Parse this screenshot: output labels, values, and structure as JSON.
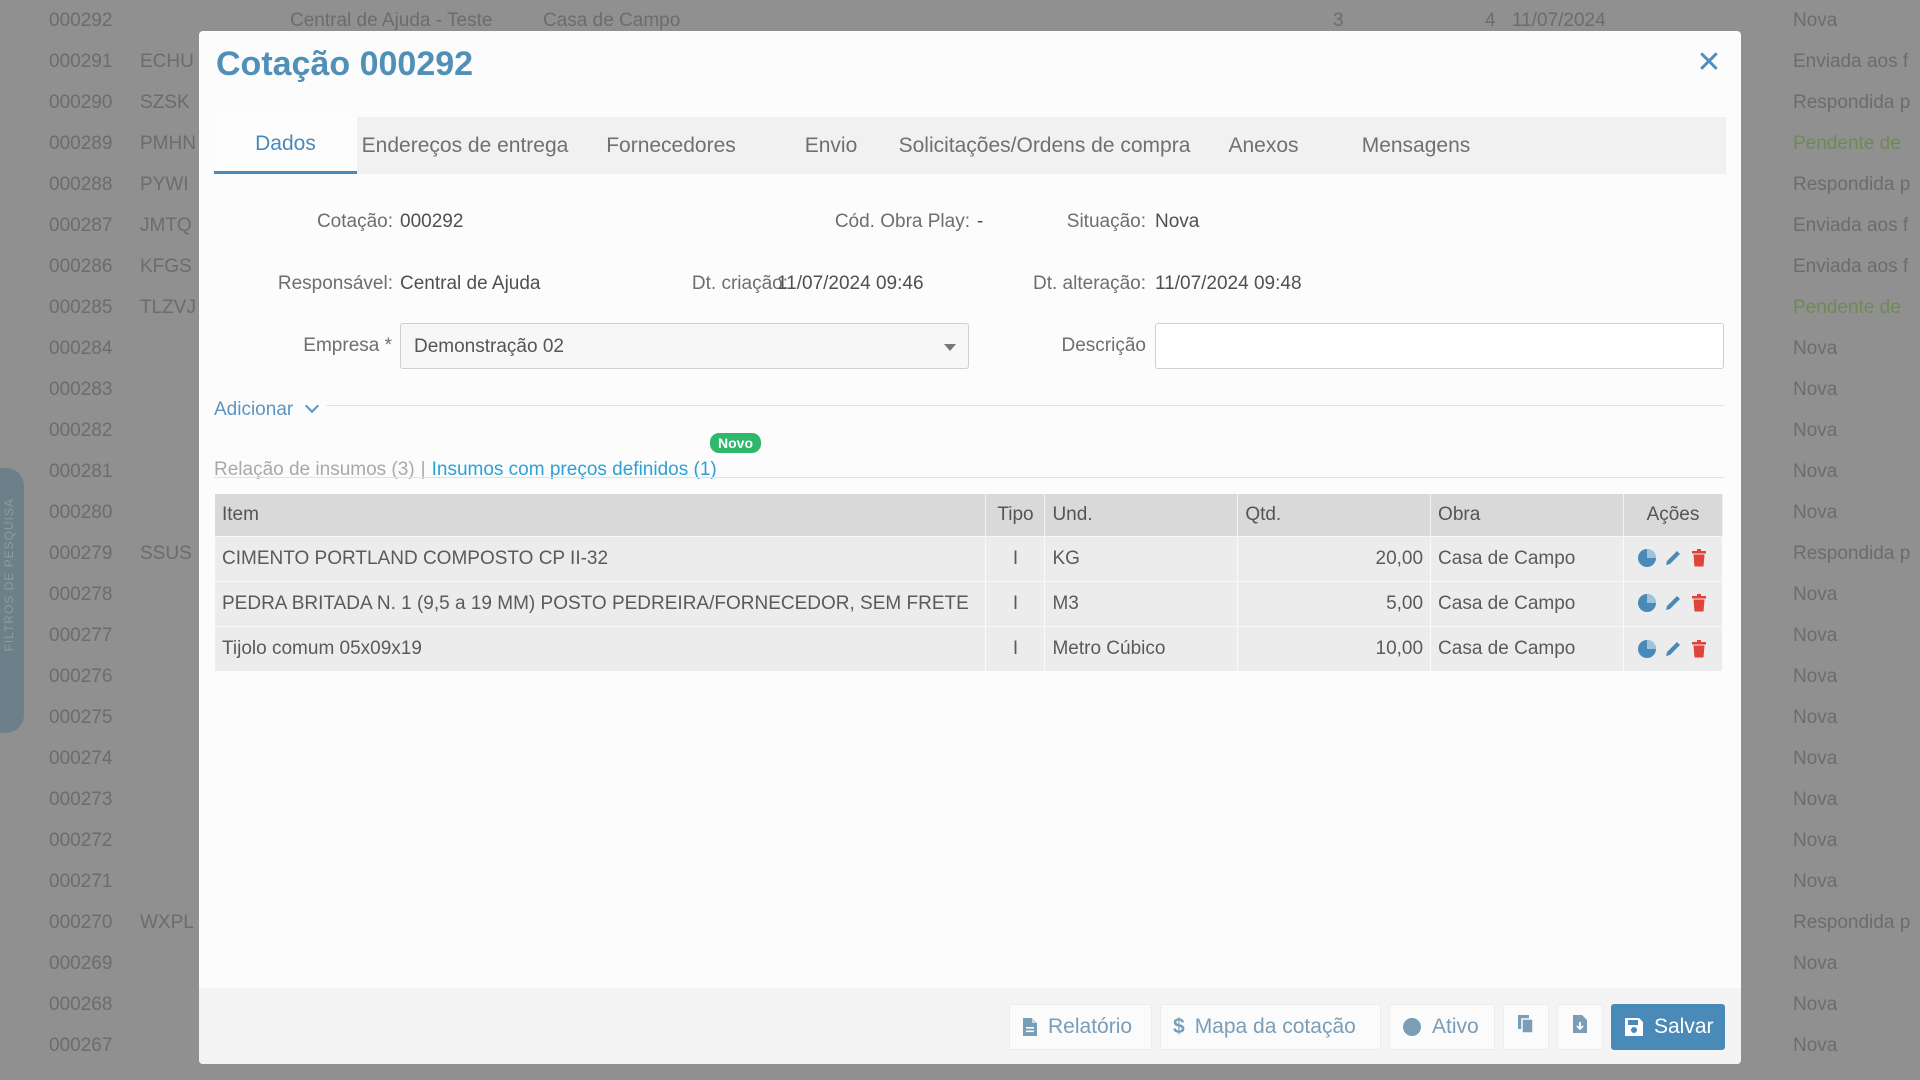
{
  "background": {
    "rows": [
      {
        "code": "000292",
        "key": "",
        "desc": "Central de Ajuda - Teste",
        "obra": "Casa de Campo",
        "n1": "3",
        "n2": "4",
        "date": "11/07/2024",
        "status": "Nova"
      },
      {
        "code": "000291",
        "key": "ECHU",
        "status": "Enviada aos f"
      },
      {
        "code": "000290",
        "key": "SZSK",
        "status": "Respondida p"
      },
      {
        "code": "000289",
        "key": "PMHN",
        "status": "Pendente de"
      },
      {
        "code": "000288",
        "key": "PYWI",
        "status": "Respondida p"
      },
      {
        "code": "000287",
        "key": "JMTQ",
        "status": "Enviada aos f"
      },
      {
        "code": "000286",
        "key": "KFGS",
        "status": "Enviada aos f"
      },
      {
        "code": "000285",
        "key": "TLZVJ",
        "status": "Pendente de"
      },
      {
        "code": "000284",
        "key": "",
        "status": "Nova"
      },
      {
        "code": "000283",
        "key": "",
        "status": "Nova"
      },
      {
        "code": "000282",
        "key": "",
        "status": "Nova"
      },
      {
        "code": "000281",
        "key": "",
        "status": "Nova"
      },
      {
        "code": "000280",
        "key": "",
        "status": "Nova"
      },
      {
        "code": "000279",
        "key": "SSUS",
        "status": "Respondida p"
      },
      {
        "code": "000278",
        "key": "",
        "status": "Nova"
      },
      {
        "code": "000277",
        "key": "",
        "status": "Nova"
      },
      {
        "code": "000276",
        "key": "",
        "status": "Nova"
      },
      {
        "code": "000275",
        "key": "",
        "status": "Nova"
      },
      {
        "code": "000274",
        "key": "",
        "status": "Nova"
      },
      {
        "code": "000273",
        "key": "",
        "status": "Nova"
      },
      {
        "code": "000272",
        "key": "",
        "status": "Nova"
      },
      {
        "code": "000271",
        "key": "",
        "status": "Nova"
      },
      {
        "code": "000270",
        "key": "WXPL",
        "status": "Respondida p"
      },
      {
        "code": "000269",
        "key": "",
        "status": "Nova"
      },
      {
        "code": "000268",
        "key": "",
        "status": "Nova"
      },
      {
        "code": "000267",
        "key": "",
        "status": "Nova"
      }
    ],
    "side_tab_label": "FILTROS DE PESQUISA"
  },
  "modal": {
    "title": "Cotação 000292",
    "tabs": [
      "Dados",
      "Endereços de entrega",
      "Fornecedores",
      "Envio",
      "Solicitações/Ordens de compra",
      "Anexos",
      "Mensagens"
    ],
    "fields": {
      "cotacao_label": "Cotação:",
      "cotacao_value": "000292",
      "cod_obra_label": "Cód. Obra Play:",
      "cod_obra_value": "-",
      "situacao_label": "Situação:",
      "situacao_value": "Nova",
      "responsavel_label": "Responsável:",
      "responsavel_value": "Central de Ajuda",
      "dt_criacao_label": "Dt. criação:",
      "dt_criacao_value": "11/07/2024 09:46",
      "dt_alteracao_label": "Dt. alteração:",
      "dt_alteracao_value": "11/07/2024 09:48",
      "empresa_label": "Empresa *",
      "empresa_value": "Demonstração 02",
      "descricao_label": "Descrição",
      "descricao_value": ""
    },
    "adicionar": "Adicionar",
    "sub_tabs": {
      "relacao": "Relação de insumos (3)",
      "separator": "|",
      "precos": "Insumos com preços definidos (1)",
      "badge": "Novo"
    },
    "table": {
      "headers": [
        "Item",
        "Tipo",
        "Und.",
        "Qtd.",
        "Obra",
        "Ações"
      ],
      "rows": [
        {
          "item": "CIMENTO PORTLAND COMPOSTO CP II-32",
          "tipo": "I",
          "und": "KG",
          "qtd": "20,00",
          "obra": "Casa de Campo"
        },
        {
          "item": "PEDRA BRITADA N. 1 (9,5 a 19 MM) POSTO PEDREIRA/FORNECEDOR, SEM FRETE",
          "tipo": "I",
          "und": "M3",
          "qtd": "5,00",
          "obra": "Casa de Campo"
        },
        {
          "item": "Tijolo comum 05x09x19",
          "tipo": "I",
          "und": "Metro Cúbico",
          "qtd": "10,00",
          "obra": "Casa de Campo"
        }
      ],
      "action_icons": [
        "pie-chart-icon",
        "pencil-icon",
        "trash-icon"
      ]
    },
    "footer": {
      "relatorio": "Relatório",
      "mapa": "Mapa da cotação",
      "ativo": "Ativo",
      "salvar": "Salvar"
    }
  },
  "colors": {
    "accent": "#4a8ab8",
    "link": "#2ea0d6",
    "badge": "#2fb86a",
    "delete": "#e0433a"
  }
}
